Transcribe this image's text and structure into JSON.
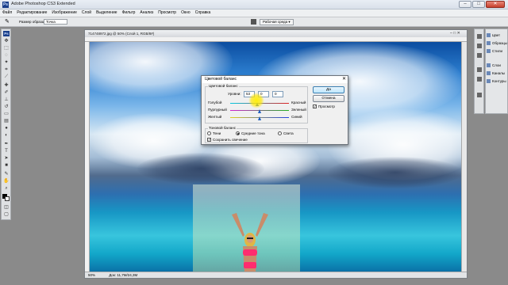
{
  "app": {
    "title": "Adobe Photoshop CS3 Extended"
  },
  "window_controls": {
    "minimize": "–",
    "maximize": "□",
    "close": "✕"
  },
  "menu": [
    "Файл",
    "Редактирование",
    "Изображение",
    "Слой",
    "Выделение",
    "Фильтр",
    "Анализ",
    "Просмотр",
    "Окно",
    "Справка"
  ],
  "options": {
    "feather_label": "Размер образца:",
    "feather_value": "Точка",
    "workspace_label": "Рабочая среда ▾"
  },
  "tools_icons": [
    "move-icon",
    "marquee-icon",
    "lasso-icon",
    "magic-wand-icon",
    "crop-icon",
    "slice-icon",
    "healing-icon",
    "brush-icon",
    "stamp-icon",
    "history-brush-icon",
    "eraser-icon",
    "gradient-icon",
    "blur-icon",
    "dodge-icon",
    "pen-icon",
    "type-icon",
    "path-select-icon",
    "shape-icon",
    "notes-icon",
    "eyedropper-icon",
    "hand-icon",
    "zoom-icon"
  ],
  "panels": {
    "items": [
      "Цвет",
      "Образцы",
      "Стили",
      "Слои",
      "Каналы",
      "Контуры"
    ]
  },
  "document": {
    "tab_title": "714748972.jpg @ 50% (Слой 1, RGB/8#)",
    "zoom": "50%",
    "status": "Док: 11,7M/24,3M"
  },
  "dialog": {
    "title": "Цветовой баланс",
    "group_balance": "Цветовой баланс",
    "levels_label": "Уровни:",
    "levels": [
      "53",
      "0",
      "0"
    ],
    "sliders": [
      {
        "left": "Голубой",
        "right": "Красный",
        "value": 53
      },
      {
        "left": "Пурпурный",
        "right": "Зеленый",
        "value": 0
      },
      {
        "left": "Желтый",
        "right": "Синий",
        "value": 0
      }
    ],
    "ok_label": "Да",
    "cancel_label": "Отмена",
    "preview_label": "Просмотр",
    "group_tone": "Тоновой баланс",
    "tone_shadows": "Тени",
    "tone_midtones": "Средние тона",
    "tone_highlights": "Света",
    "preserve_luminosity": "Сохранить свечение",
    "preview_checked": true,
    "preserve_checked": true,
    "tone_selected": "Средние тона"
  }
}
